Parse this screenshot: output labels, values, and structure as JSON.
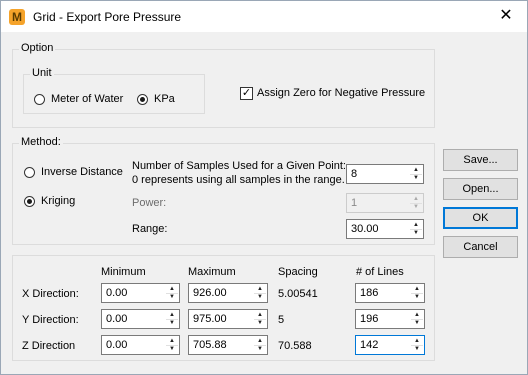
{
  "window": {
    "title": "Grid - Export Pore Pressure",
    "icon_letter": "M",
    "close_glyph": "✕"
  },
  "option": {
    "group_label": "Option",
    "unit": {
      "group_label": "Unit",
      "meter_of_water": "Meter of Water",
      "kpa": "KPa",
      "selected": "KPa"
    },
    "assign_zero": {
      "label": "Assign Zero for Negative Pressure",
      "checked": true,
      "check_glyph": "✓"
    }
  },
  "method": {
    "group_label": "Method:",
    "inverse_distance": "Inverse Distance",
    "kriging": "Kriging",
    "selected": "Kriging",
    "samples_label_line1": "Number of Samples Used for a Given Point:",
    "samples_label_line2": "0 represents using all samples in the range.",
    "samples_value": "8",
    "power_label": "Power:",
    "power_value": "1",
    "range_label": "Range:",
    "range_value": "30.00"
  },
  "grid": {
    "headers": {
      "minimum": "Minimum",
      "maximum": "Maximum",
      "spacing": "Spacing",
      "lines": "# of Lines"
    },
    "rows": [
      {
        "label": "X Direction:",
        "minimum": "0.00",
        "maximum": "926.00",
        "spacing": "5.00541",
        "lines": "186"
      },
      {
        "label": "Y Direction:",
        "minimum": "0.00",
        "maximum": "975.00",
        "spacing": "5",
        "lines": "196"
      },
      {
        "label": "Z Direction",
        "minimum": "0.00",
        "maximum": "705.88",
        "spacing": "70.588",
        "lines": "142"
      }
    ]
  },
  "buttons": {
    "save": "Save...",
    "open": "Open...",
    "ok": "OK",
    "cancel": "Cancel"
  },
  "spin_glyphs": {
    "up": "▲",
    "down": "▼"
  }
}
